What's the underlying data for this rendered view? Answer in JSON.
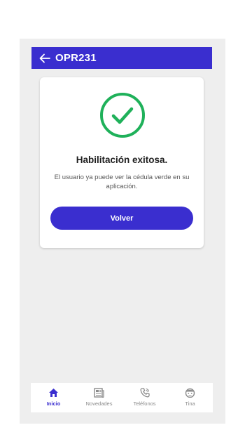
{
  "appbar": {
    "title": "OPR231",
    "back_icon": "arrow-left-icon"
  },
  "card": {
    "icon": "check-circle-icon",
    "title": "Habilitación exitosa.",
    "message": "El usuario ya puede ver la cédula verde en su aplicación.",
    "button_label": "Volver"
  },
  "bottom_nav": {
    "items": [
      {
        "label": "Inicio",
        "icon": "home-icon",
        "active": true
      },
      {
        "label": "Novedades",
        "icon": "newspaper-icon",
        "active": false
      },
      {
        "label": "Teléfonos",
        "icon": "phone-icon",
        "active": false
      },
      {
        "label": "Tina",
        "icon": "avatar-icon",
        "active": false
      }
    ]
  },
  "colors": {
    "primary": "#3a2ecf",
    "success": "#1fb15a",
    "background": "#eeeeee",
    "inactive": "#8a8a8a"
  }
}
